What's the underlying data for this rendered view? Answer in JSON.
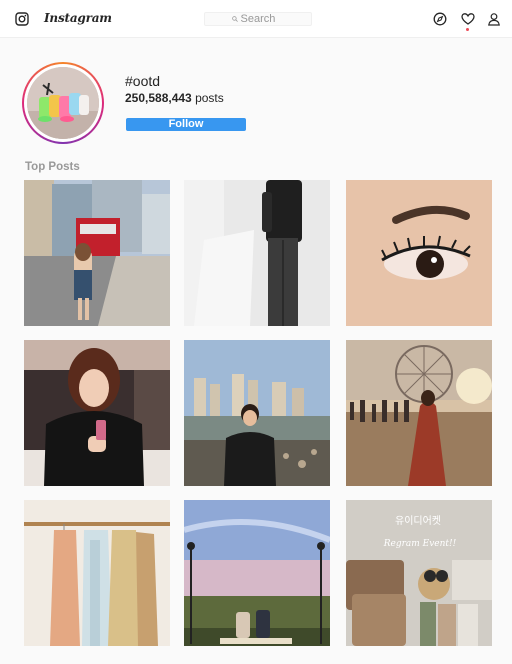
{
  "nav": {
    "brand": "Instagram",
    "search_placeholder": "Search",
    "icons": [
      "instagram-camera-icon",
      "compass-icon",
      "heart-icon",
      "user-icon"
    ]
  },
  "header": {
    "hashtag": "#ootd",
    "posts_count": "250,588,443",
    "posts_label": "posts",
    "follow_label": "Follow"
  },
  "top_posts": {
    "title": "Top Posts",
    "overlay_texts": [
      "유이디어켓",
      "Regram Event!!"
    ]
  },
  "colors": {
    "accent": "#3897f0",
    "notification": "#ed4956",
    "section_title": "#999999"
  }
}
